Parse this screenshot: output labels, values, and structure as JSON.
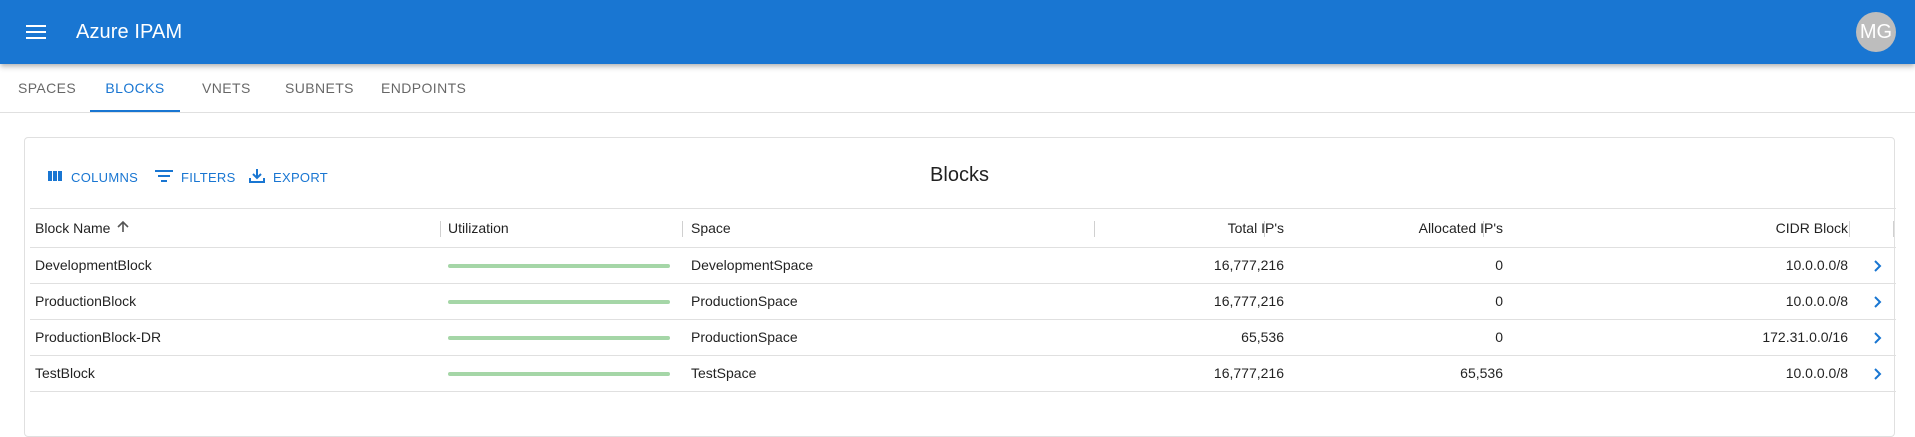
{
  "appbar": {
    "title": "Azure IPAM",
    "avatar_initials": "MG",
    "menu_icon": "hamburger-menu-icon"
  },
  "tabs": [
    {
      "label": "SPACES",
      "active": false
    },
    {
      "label": "BLOCKS",
      "active": true
    },
    {
      "label": "VNETS",
      "active": false
    },
    {
      "label": "SUBNETS",
      "active": false
    },
    {
      "label": "ENDPOINTS",
      "active": false
    }
  ],
  "grid": {
    "title": "Blocks",
    "toolbar": {
      "columns_label": "COLUMNS",
      "filters_label": "FILTERS",
      "export_label": "EXPORT"
    },
    "columns": {
      "name": "Block Name",
      "utilization": "Utilization",
      "space": "Space",
      "total": "Total IP's",
      "allocated": "Allocated IP's",
      "cidr": "CIDR Block"
    },
    "sort": {
      "column": "Block Name",
      "direction": "ascending"
    },
    "rows": [
      {
        "name": "DevelopmentBlock",
        "utilization": 0,
        "space": "DevelopmentSpace",
        "total": "16,777,216",
        "allocated": "0",
        "cidr": "10.0.0.0/8"
      },
      {
        "name": "ProductionBlock",
        "utilization": 0,
        "space": "ProductionSpace",
        "total": "16,777,216",
        "allocated": "0",
        "cidr": "10.0.0.0/8"
      },
      {
        "name": "ProductionBlock-DR",
        "utilization": 0,
        "space": "ProductionSpace",
        "total": "65,536",
        "allocated": "0",
        "cidr": "172.31.0.0/16"
      },
      {
        "name": "TestBlock",
        "utilization": 0,
        "space": "TestSpace",
        "total": "16,777,216",
        "allocated": "65,536",
        "cidr": "10.0.0.0/8"
      }
    ]
  },
  "colors": {
    "primary": "#1976d2",
    "utilization_bar": "#a5d6a7"
  }
}
